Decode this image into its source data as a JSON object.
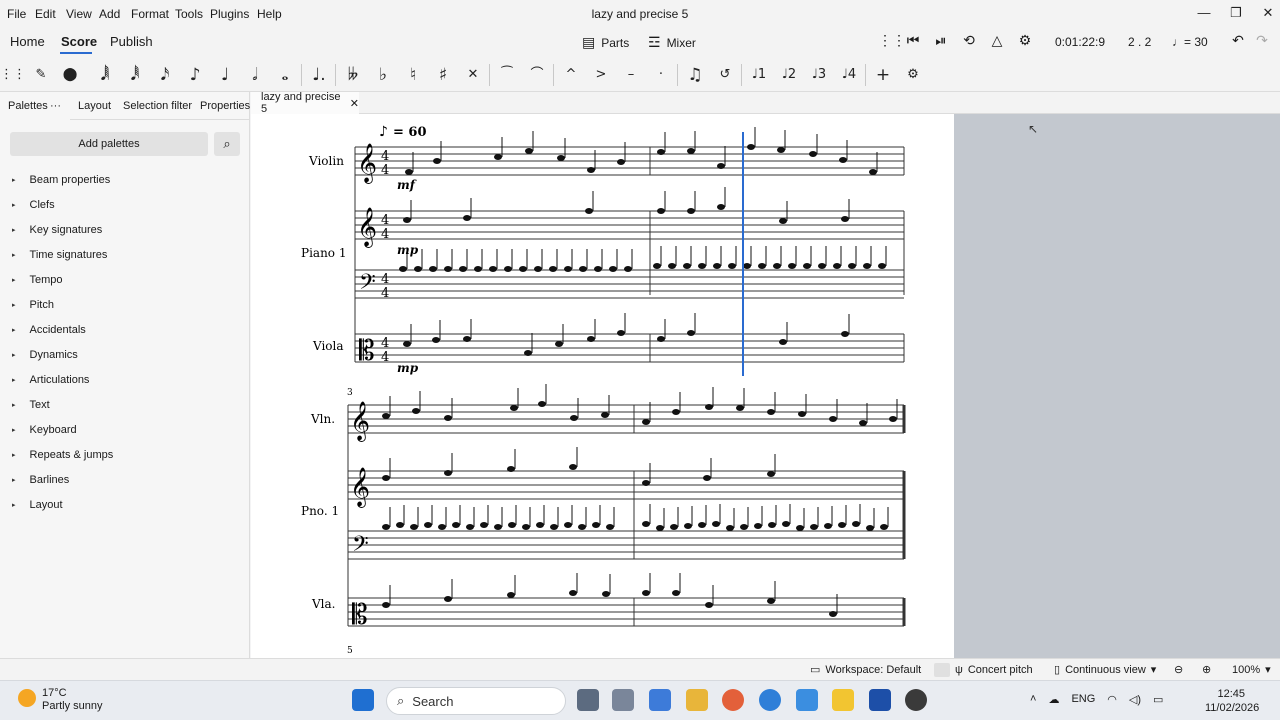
{
  "window": {
    "title": "lazy and precise 5",
    "controls": {
      "minimize": "—",
      "maximize": "❐",
      "close": "✕"
    }
  },
  "menu": [
    "File",
    "Edit",
    "View",
    "Add",
    "Format",
    "Tools",
    "Plugins",
    "Help"
  ],
  "tabs": {
    "home": "Home",
    "score": "Score",
    "publish": "Publish"
  },
  "toolbar": {
    "parts": "Parts",
    "mixer": "Mixer",
    "time": "0:01:22:9",
    "position": "2 . 2",
    "tempo": "= 30"
  },
  "note_input": {
    "durations": [
      "64th",
      "32nd",
      "16th",
      "8th",
      "quarter",
      "half",
      "whole",
      "dotted"
    ],
    "voices": [
      "1",
      "2",
      "3",
      "4"
    ]
  },
  "left_panel": {
    "tabs": [
      "Palettes",
      "Layout",
      "Selection filter",
      "Properties"
    ],
    "add_palettes": "Add palettes",
    "palettes": [
      "Beam properties",
      "Clefs",
      "Key signatures",
      "Time signatures",
      "Tempo",
      "Pitch",
      "Accidentals",
      "Dynamics",
      "Articulations",
      "Text",
      "Keyboard",
      "Repeats & jumps",
      "Barlines",
      "Layout"
    ]
  },
  "document_tab": "lazy and precise 5",
  "score": {
    "tempo_marking": "= 60",
    "system1": {
      "instruments": [
        "Violin",
        "Piano 1",
        "Viola"
      ],
      "dynamics": [
        "mf",
        "mp",
        "mp"
      ],
      "time_signature": "4/4"
    },
    "system2": {
      "measure_number": "3",
      "instruments": [
        "Vln.",
        "Pno. 1",
        "Vla."
      ]
    },
    "next_measure_number": "5"
  },
  "status": {
    "workspace": "Workspace: Default",
    "concert_pitch": "Concert pitch",
    "view_mode": "Continuous view",
    "zoom": "100%"
  },
  "taskbar": {
    "temperature": "17°C",
    "weather": "Partly sunny",
    "search": "Search",
    "language": "ENG",
    "time": "12:45",
    "date": "11/02/2026"
  },
  "colors": {
    "accent": "#2a6bd0",
    "playback_cursor": "#2a6bd0",
    "sidebar_bg": "#f6f6f6",
    "offscreen_bg": "#c3c8cf"
  }
}
